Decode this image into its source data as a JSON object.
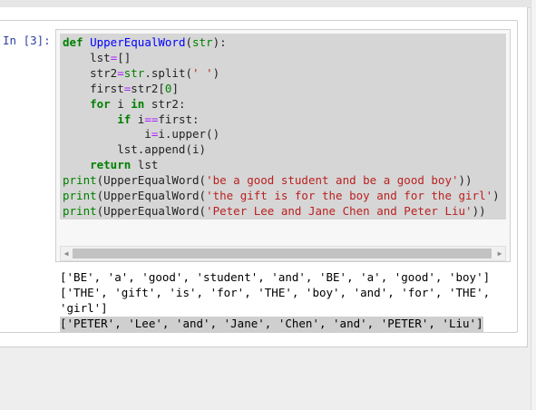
{
  "cell": {
    "prompt": "In [3]:",
    "code_lines": [
      [
        {
          "t": "def",
          "c": "kw"
        },
        {
          "t": " "
        },
        {
          "t": "UpperEqualWord",
          "c": "fn"
        },
        {
          "t": "("
        },
        {
          "t": "str",
          "c": "bi"
        },
        {
          "t": "):"
        }
      ],
      [
        {
          "t": "    lst"
        },
        {
          "t": "=",
          "c": "op"
        },
        {
          "t": "[]"
        }
      ],
      [
        {
          "t": "    str2"
        },
        {
          "t": "=",
          "c": "op"
        },
        {
          "t": "str",
          "c": "bi"
        },
        {
          "t": ".split("
        },
        {
          "t": "' '",
          "c": "st"
        },
        {
          "t": ")"
        }
      ],
      [
        {
          "t": "    first"
        },
        {
          "t": "=",
          "c": "op"
        },
        {
          "t": "str2["
        },
        {
          "t": "0",
          "c": "nm"
        },
        {
          "t": "]"
        }
      ],
      [
        {
          "t": "    "
        },
        {
          "t": "for",
          "c": "kw"
        },
        {
          "t": " i "
        },
        {
          "t": "in",
          "c": "kw"
        },
        {
          "t": " str2:"
        }
      ],
      [
        {
          "t": "        "
        },
        {
          "t": "if",
          "c": "kw"
        },
        {
          "t": " i"
        },
        {
          "t": "==",
          "c": "op"
        },
        {
          "t": "first:"
        }
      ],
      [
        {
          "t": "            i"
        },
        {
          "t": "=",
          "c": "op"
        },
        {
          "t": "i.upper()"
        }
      ],
      [
        {
          "t": "        lst.append(i)"
        }
      ],
      [
        {
          "t": "    "
        },
        {
          "t": "return",
          "c": "kw"
        },
        {
          "t": " lst"
        }
      ],
      [
        {
          "t": "print",
          "c": "bi"
        },
        {
          "t": "(UpperEqualWord("
        },
        {
          "t": "'be a good student and be a good boy'",
          "c": "st"
        },
        {
          "t": "))"
        }
      ],
      [
        {
          "t": "print",
          "c": "bi"
        },
        {
          "t": "(UpperEqualWord("
        },
        {
          "t": "'the gift is for the boy and for the girl'",
          "c": "st"
        },
        {
          "t": ")"
        }
      ],
      [
        {
          "t": "print",
          "c": "bi"
        },
        {
          "t": "(UpperEqualWord("
        },
        {
          "t": "'Peter Lee and Jane Chen and Peter Liu'",
          "c": "st"
        },
        {
          "t": "))"
        }
      ]
    ],
    "output_lines": [
      "['BE', 'a', 'good', 'student', 'and', 'BE', 'a', 'good', 'boy']",
      "['THE', 'gift', 'is', 'for', 'THE', 'boy', 'and', 'for', 'THE',",
      "'girl']",
      "['PETER', 'Lee', 'and', 'Jane', 'Chen', 'and', 'PETER', 'Liu']"
    ],
    "highlighted_output_line": 3,
    "scrollbar": {
      "left_arrow": "◀",
      "right_arrow": "▶"
    }
  }
}
